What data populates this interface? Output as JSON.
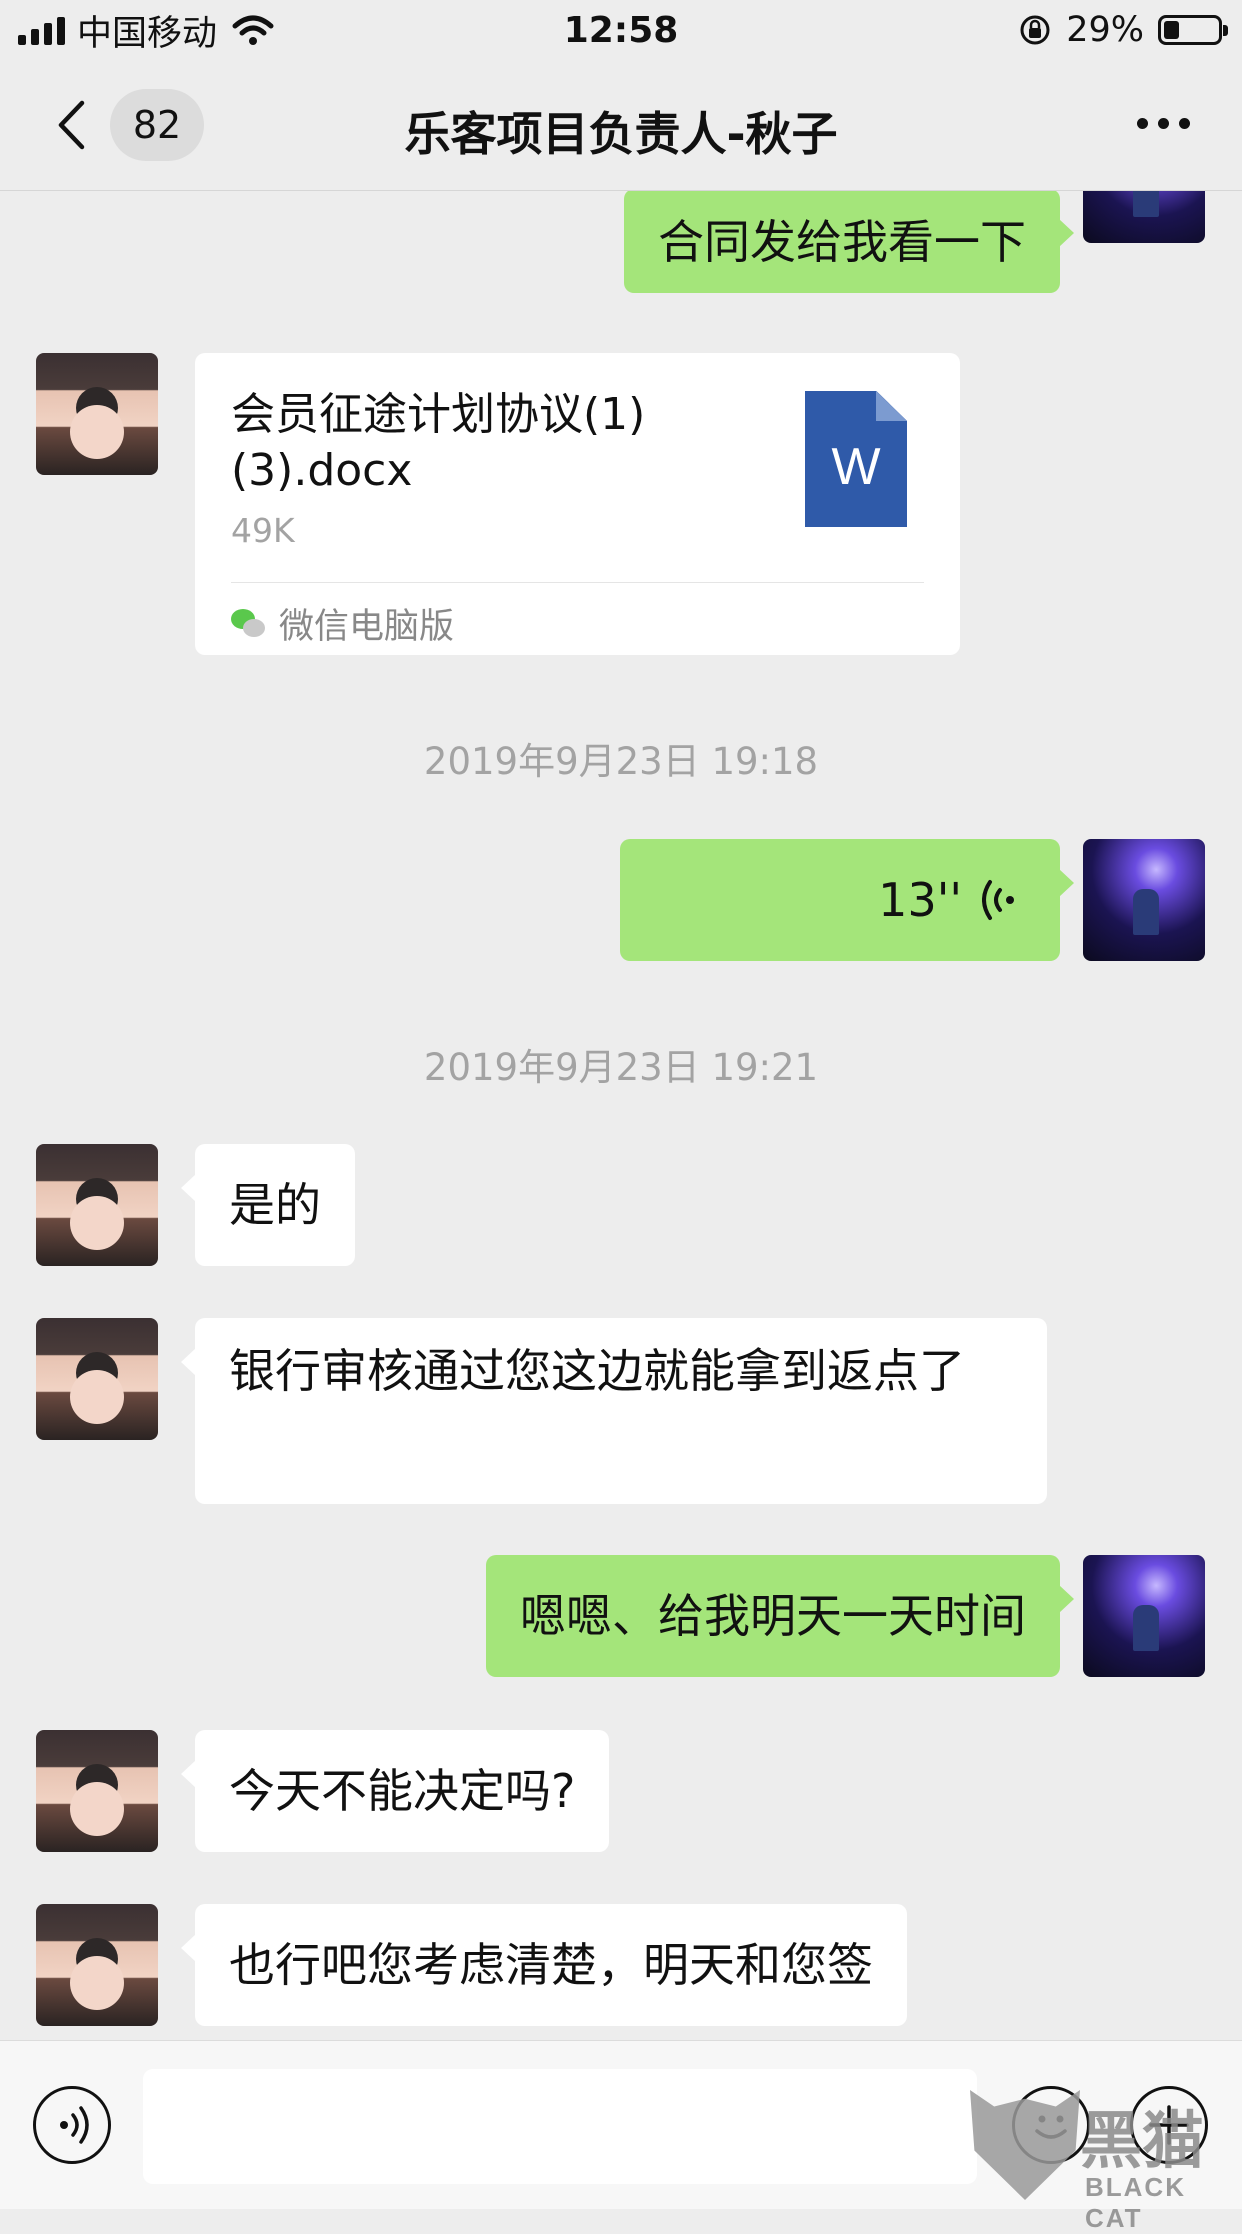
{
  "status_bar": {
    "carrier": "中国移动",
    "time": "12:58",
    "battery": "29%",
    "battery_level": 0.29
  },
  "nav": {
    "back_count": "82",
    "title": "乐客项目负责人-秋子"
  },
  "messages": {
    "m1": "合同发给我看一下",
    "file": {
      "name_line1": "会员征途计划协议(1)",
      "name_line2": "(3).docx",
      "size": "49K",
      "icon_letter": "W",
      "source": "微信电脑版"
    },
    "t1": "2019年9月23日 19:18",
    "voice_duration": "13''",
    "t2": "2019年9月23日 19:21",
    "m2": "是的",
    "m3": "银行审核通过您这边就能拿到返点了",
    "m4": "嗯嗯、给我明天一天时间",
    "m5": "今天不能决定吗?",
    "m6": "也行吧您考虑清楚，明天和您签"
  },
  "watermark": {
    "main": "黑猫",
    "sub": "BLACK CAT"
  }
}
